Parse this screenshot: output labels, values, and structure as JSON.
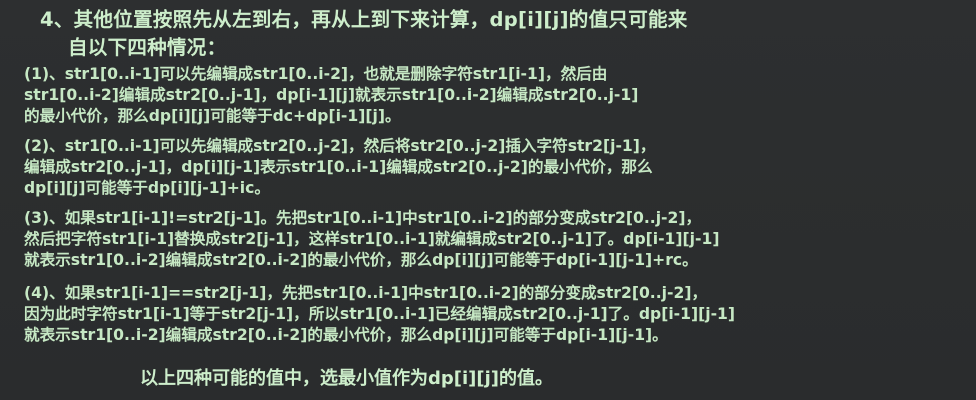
{
  "heading": {
    "line1": "4、其他位置按照先从左到右，再从上到下来计算，dp[i][j]的值只可能来",
    "line2": "自以下四种情况："
  },
  "cases": [
    {
      "lines": [
        "(1)、str1[0..i-1]可以先编辑成str1[0..i-2]，也就是删除字符str1[i-1]，然后由",
        "str1[0..i-2]编辑成str2[0..j-1]，dp[i-1][j]就表示str1[0..i-2]编辑成str2[0..j-1]",
        "的最小代价，那么dp[i][j]可能等于dc+dp[i-1][j]。"
      ]
    },
    {
      "lines": [
        "(2)、str1[0..i-1]可以先编辑成str2[0..j-2]，然后将str2[0..j-2]插入字符str2[j-1]，",
        "编辑成str2[0..j-1]，dp[i][j-1]表示str1[0..i-1]编辑成str2[0..j-2]的最小代价，那么",
        "dp[i][j]可能等于dp[i][j-1]+ic。"
      ]
    },
    {
      "lines": [
        "(3)、如果str1[i-1]!=str2[j-1]。先把str1[0..i-1]中str1[0..i-2]的部分变成str2[0..j-2]，",
        "然后把字符str1[i-1]替换成str2[j-1]，这样str1[0..i-1]就编辑成str2[0..j-1]了。dp[i-1][j-1]",
        "就表示str1[0..i-2]编辑成str2[0..i-2]的最小代价，那么dp[i][j]可能等于dp[i-1][j-1]+rc。"
      ]
    },
    {
      "lines": [
        "(4)、如果str1[i-1]==str2[j-1]，先把str1[0..i-1]中str1[0..i-2]的部分变成str2[0..j-2]，",
        "因为此时字符str1[i-1]等于str2[j-1]，所以str1[0..i-1]已经编辑成str2[0..j-1]了。dp[i-1][j-1]",
        "就表示str1[0..i-2]编辑成str2[0..i-2]的最小代价，那么dp[i][j]可能等于dp[i-1][j-1]。"
      ]
    }
  ],
  "conclusion": "以上四种可能的值中，选最小值作为dp[i][j]的值。"
}
